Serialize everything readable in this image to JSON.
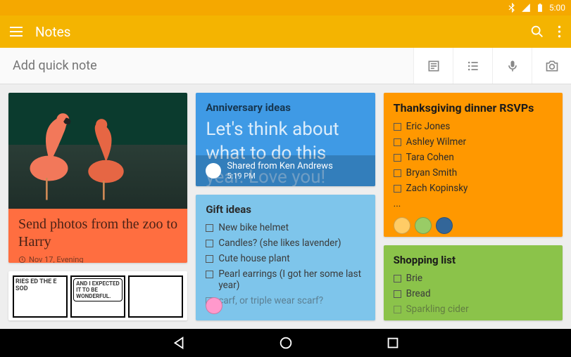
{
  "status": {
    "time": "5:00"
  },
  "appbar": {
    "title": "Notes"
  },
  "quick": {
    "placeholder": "Add quick note"
  },
  "notes": {
    "flamingo": {
      "title": "Send photos from the zoo to Harry",
      "reminder": "Nov 17, Evening"
    },
    "comic": {
      "panel1": "RIES ED THE E SOD",
      "bubble": "AND I EXPECTED IT TO BE WONDERFUL."
    },
    "anniversary": {
      "title": "Anniversary ideas",
      "body_line1": "Let's think about",
      "body_line2": "what to do this",
      "body_line3_ghost": "year. Love you!",
      "shared_from": "Shared from Ken Andrews",
      "shared_time": "5:19 PM"
    },
    "gifts": {
      "title": "Gift ideas",
      "items": [
        "New bike helmet",
        "Candles? (she likes lavender)",
        "Cute house plant",
        "Pearl earrings (I got her some last year)"
      ],
      "faded": "carf, or triple wear scarf?"
    },
    "rsvps": {
      "title": "Thanksgiving dinner RSVPs",
      "items": [
        "Eric Jones",
        "Ashley Wilmer",
        "Tara Cohen",
        "Bryan Smith",
        "Zach Kopinsky"
      ],
      "more": "..."
    },
    "shopping": {
      "title": "Shopping list",
      "items": [
        "Brie",
        "Bread"
      ],
      "faded": "Sparkling cider"
    }
  }
}
